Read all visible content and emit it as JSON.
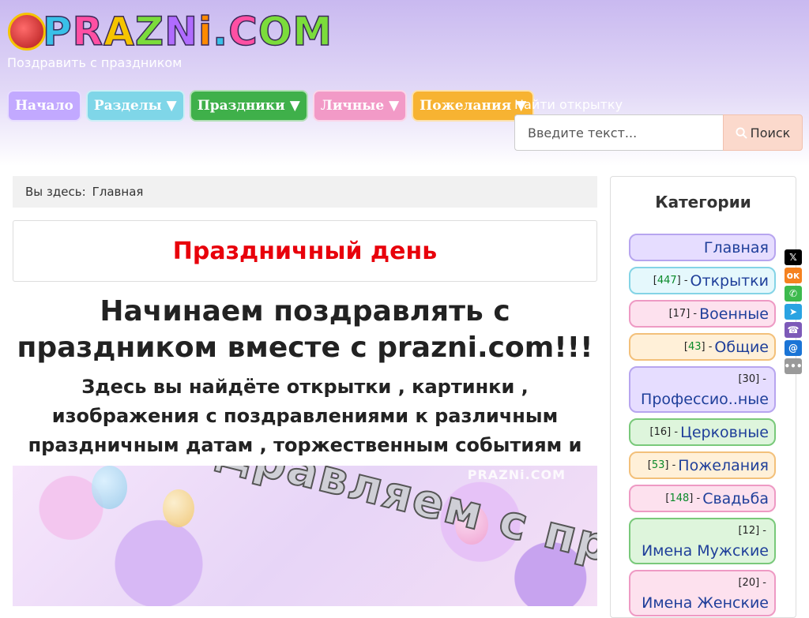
{
  "header": {
    "logo_text": [
      "P",
      "R",
      "A",
      "Z",
      "N",
      "i",
      ".",
      "C",
      "OM"
    ],
    "tagline": "Поздравить с праздником"
  },
  "nav": {
    "items": [
      {
        "label": "Начало",
        "color": "#c2a9ff"
      },
      {
        "label": "Разделы ▼",
        "color": "#7fd6e8"
      },
      {
        "label": "Праздники ▼",
        "color": "#3fb04a"
      },
      {
        "label": "Личные ▼",
        "color": "#f29ac7"
      },
      {
        "label": "Пожелания ▼",
        "color": "#f7b332"
      }
    ]
  },
  "search": {
    "label": "Найти открытку",
    "placeholder": "Введите текст...",
    "button_label": "Поиск"
  },
  "breadcrumb": {
    "prefix": "Вы здесь:",
    "current": "Главная"
  },
  "main": {
    "page_title": "Праздничный день",
    "heading": "Начинаем поздравлять с праздником вместе с prazni.com!!!",
    "subheading": "Здесь вы найдёте открытки , картинки , изображения с поздравлениями к различным праздничным датам , торжественным событиям и знаменательным дням.",
    "banner": {
      "watermark": "PRAZNi.COM",
      "text": "Поздравляем с праздником!"
    }
  },
  "sidebar": {
    "title": "Категории",
    "categories": [
      {
        "name": "Главная",
        "count": null,
        "style": "purple"
      },
      {
        "name": "Открытки",
        "count": "447",
        "style": "cyan"
      },
      {
        "name": "Военные",
        "count": "17",
        "style": "pink"
      },
      {
        "name": "Общие",
        "count": "43",
        "style": "orange"
      },
      {
        "name": "Професcио..ные",
        "count": "30",
        "style": "purple"
      },
      {
        "name": "Церковные",
        "count": "16",
        "style": "green"
      },
      {
        "name": "Пожелания",
        "count": "53",
        "style": "orange"
      },
      {
        "name": "Свадьба",
        "count": "148",
        "style": "pink"
      },
      {
        "name": "Имена Мужские",
        "count": "12",
        "style": "green"
      },
      {
        "name": "Имена Женские",
        "count": "20",
        "style": "pink"
      }
    ]
  },
  "share": {
    "icons": [
      "x-icon",
      "odnoklassniki-icon",
      "whatsapp-icon",
      "telegram-icon",
      "viber-icon",
      "mail-icon",
      "more-icon"
    ]
  }
}
